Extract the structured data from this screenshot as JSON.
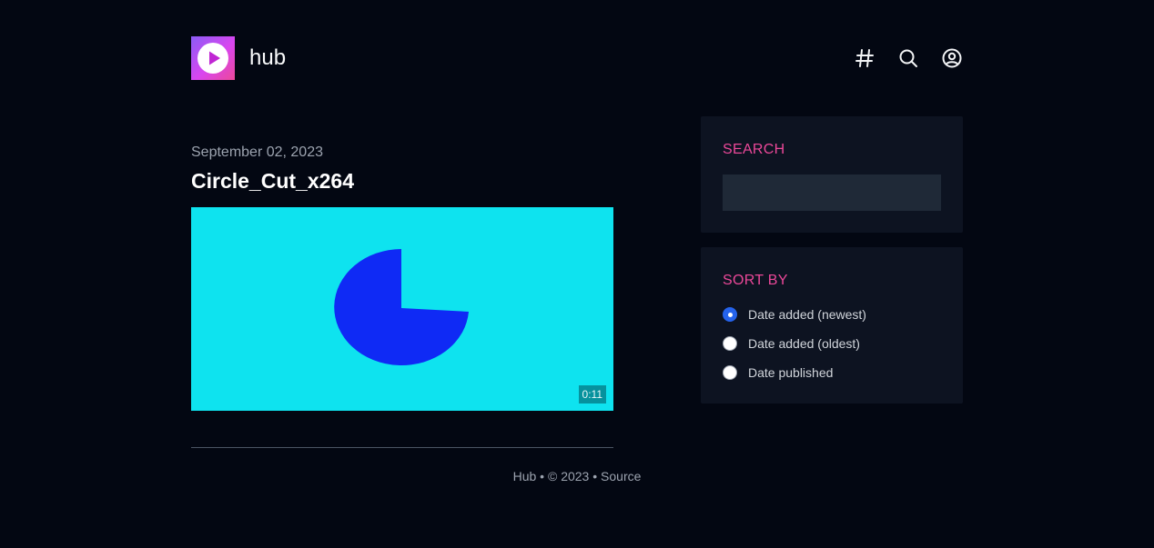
{
  "header": {
    "site_name": "hub",
    "logo_icon": "play-icon",
    "nav_icons": [
      "hash-icon",
      "search-icon",
      "user-circle-icon"
    ]
  },
  "post": {
    "date": "September 02, 2023",
    "title": "Circle_Cut_x264",
    "duration": "0:11",
    "thumbnail_bg": "#0ee3ef",
    "shape_color": "#0f2af5"
  },
  "sidebar": {
    "search": {
      "title": "SEARCH",
      "value": "",
      "placeholder": ""
    },
    "sort": {
      "title": "SORT BY",
      "options": [
        {
          "label": "Date added (newest)",
          "checked": true
        },
        {
          "label": "Date added (oldest)",
          "checked": false
        },
        {
          "label": "Date published",
          "checked": false
        }
      ]
    }
  },
  "footer": {
    "site": "Hub",
    "sep1": " • ",
    "copyright": "© 2023",
    "sep2": " • ",
    "source": "Source"
  },
  "colors": {
    "background": "#030712",
    "accent": "#ec4899",
    "panel": "#0d1321",
    "radio_checked": "#2563eb"
  }
}
